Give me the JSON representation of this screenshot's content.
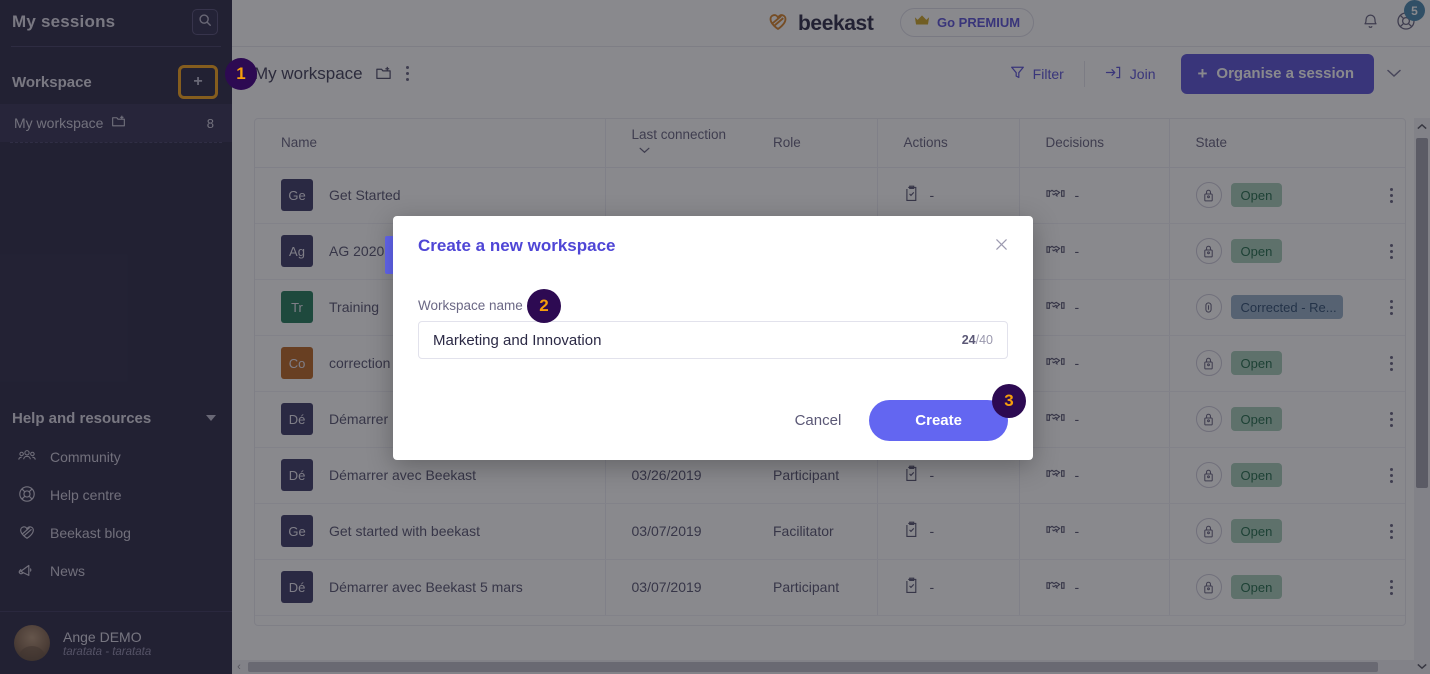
{
  "sidebar": {
    "title": "My sessions",
    "search_icon": "search-icon",
    "workspace_section": "Workspace",
    "add_label": "+",
    "workspace_item": {
      "label": "My workspace",
      "icon": "folder-add-icon",
      "count": "8"
    },
    "help_section": "Help and resources",
    "links": [
      {
        "label": "Community",
        "icon": "people-icon"
      },
      {
        "label": "Help centre",
        "icon": "lifebuoy-icon"
      },
      {
        "label": "Beekast blog",
        "icon": "blog-icon"
      },
      {
        "label": "News",
        "icon": "megaphone-icon"
      }
    ],
    "user": {
      "name": "Ange DEMO",
      "subtitle": "taratata - taratata"
    }
  },
  "header": {
    "brand": "beekast",
    "premium_label": "Go PREMIUM",
    "crown_icon": "crown-icon",
    "bell_icon": "bell-icon",
    "help_icon": "lifebuoy-icon",
    "help_badge": "5"
  },
  "toolbar": {
    "workspace_title": "My workspace",
    "folder_icon": "folder-add-icon",
    "more_icon": "kebab-menu-icon",
    "filter_label": "Filter",
    "filter_icon": "funnel-icon",
    "join_label": "Join",
    "join_icon": "enter-icon",
    "organise_label": "Organise a session",
    "organise_caret": "chevron-down-icon"
  },
  "table": {
    "columns": [
      "Name",
      "Last connection",
      "Role",
      "Actions",
      "Decisions",
      "State"
    ],
    "sort_icon": "chevron-down-icon",
    "rows": [
      {
        "initials": "Ge",
        "color": "#2e2a5c",
        "name": "Get Started",
        "date": "",
        "role": "",
        "actions": "-",
        "decisions": "-",
        "state": "Open",
        "state_type": "open"
      },
      {
        "initials": "Ag",
        "color": "#2e2a5c",
        "name": "AG 2020",
        "date": "",
        "role": "",
        "actions": "-",
        "decisions": "-",
        "state": "Open",
        "state_type": "open"
      },
      {
        "initials": "Tr",
        "color": "#13714f",
        "name": "Training",
        "date": "",
        "role": "",
        "actions": "-",
        "decisions": "-",
        "state": "Corrected - Re...",
        "state_type": "corrected"
      },
      {
        "initials": "Co",
        "color": "#b65c12",
        "name": "correction",
        "date": "",
        "role": "",
        "actions": "-",
        "decisions": "-",
        "state": "Open",
        "state_type": "open"
      },
      {
        "initials": "Dé",
        "color": "#2e2a5c",
        "name": "Démarrer",
        "date": "",
        "role": "",
        "actions": "-",
        "decisions": "-",
        "state": "Open",
        "state_type": "open"
      },
      {
        "initials": "Dé",
        "color": "#2e2a5c",
        "name": "Démarrer avec Beekast",
        "date": "03/26/2019",
        "role": "Participant",
        "actions": "-",
        "decisions": "-",
        "state": "Open",
        "state_type": "open"
      },
      {
        "initials": "Ge",
        "color": "#2e2a5c",
        "name": "Get started with beekast",
        "date": "03/07/2019",
        "role": "Facilitator",
        "actions": "-",
        "decisions": "-",
        "state": "Open",
        "state_type": "open"
      },
      {
        "initials": "Dé",
        "color": "#2e2a5c",
        "name": "Démarrer avec Beekast 5 mars",
        "date": "03/07/2019",
        "role": "Participant",
        "actions": "-",
        "decisions": "-",
        "state": "Open",
        "state_type": "open"
      }
    ]
  },
  "modal": {
    "title": "Create a new workspace",
    "close_icon": "close-icon",
    "field_label": "Workspace name",
    "field_value": "Marketing and Innovation",
    "count_current": "24",
    "count_max": "/40",
    "cancel_label": "Cancel",
    "create_label": "Create"
  },
  "annotations": {
    "step1": "1",
    "step2": "2",
    "step3": "3"
  },
  "colors": {
    "accent": "#4f46d6",
    "modal_button": "#6366f1",
    "sidebar_bg": "#1c1a38",
    "badge_bg": "#2d0a52",
    "badge_fg": "#f59e0b",
    "highlight_border": "#f59e0b",
    "state_open_bg": "#9fc9b3",
    "state_corrected_bg": "#8fa9c4"
  }
}
